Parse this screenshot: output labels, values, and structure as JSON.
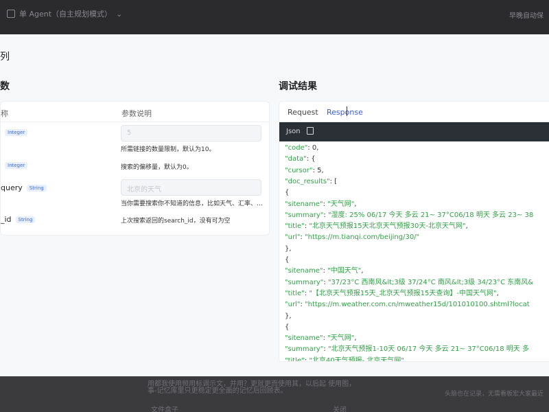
{
  "topbar": {
    "left": "单 Agent（自主规划模式）",
    "right": "早晚自动保"
  },
  "modal": {
    "title": "列",
    "params_title": "数",
    "result_title": "调试结果"
  },
  "params": {
    "col_name": "称",
    "col_desc": "参数说明",
    "rows": [
      {
        "name": "",
        "type": "Integer",
        "placeholder": "5",
        "desc": "所需链接的数量限制，默认为10。"
      },
      {
        "name": "",
        "type": "Integer",
        "placeholder": "",
        "desc": "搜索的偏移量，默认为0。"
      },
      {
        "name": "query",
        "type": "String",
        "placeholder": "北京的天气",
        "desc": "当你需要搜索你不知道的信息，比如天气、汇率、…"
      },
      {
        "name": "_id",
        "type": "String",
        "placeholder": "",
        "desc": "上次搜索返回的search_id，没有可为空"
      }
    ]
  },
  "result": {
    "tab_request": "Request",
    "tab_response": "Response",
    "code_label": "Json",
    "lines": [
      "  \"code\": 0,",
      "  \"data\": {",
      "    \"cursor\": 5,",
      "    \"doc_results\": [",
      "      {",
      "        \"sitename\": \"天气网\",",
      "        \"summary\": \"湿度: 25% 06/17  今天 多云 21~ 37°C06/18  明天 多云 23~ 38",
      "        \"title\": \"北京天气预报15天北京天气预报30天-北京天气网\",",
      "        \"url\": \"https://m.tianqi.com/beijing/30/\"",
      "      },",
      "      {",
      "        \"sitename\": \"中国天气\",",
      "        \"summary\": \"37/23°C 西南风&lt;3级 37/24°C 南风&lt;3级 34/23°C 东南风&",
      "        \"title\": \"【北京天气预报15天_北京天气预报15天查询】-中国天气网\",",
      "        \"url\": \"https://m.weather.com.cn/mweather15d/101010100.shtml?locat",
      "      },",
      "      {",
      "        \"sitename\": \"天气网\",",
      "        \"summary\": \"北京天气预报1-10天 06/17 今天 多云 21~ 37°C06/18 明天 多",
      "        \"title\": \"北京40天气预报- 北京天气网\","
    ]
  },
  "bottombar": {
    "line1": "用都我使用频用标调示文，并用？更就更而使用其，以后起 使用图，",
    "line2": "事-记忆库里只更稳定更全面的记忆后回顾表。",
    "right": "头脑也在记录，无需看板宏大家最近",
    "foot": "文件盒子",
    "foot2": "关闭"
  }
}
